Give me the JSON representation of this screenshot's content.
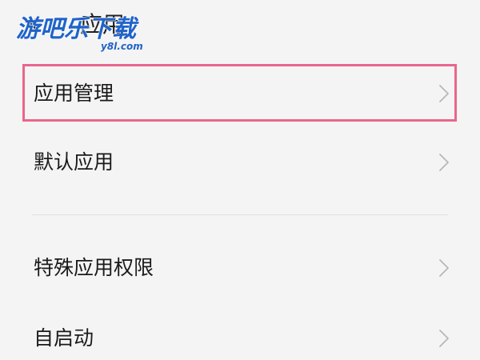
{
  "header": {
    "title": "应用",
    "back_icon": "back-arrow-icon"
  },
  "watermark": {
    "text": "游吧乐下载",
    "site": "y8l.com"
  },
  "settings": {
    "items": [
      {
        "label": "应用管理",
        "highlighted": true
      },
      {
        "label": "默认应用",
        "highlighted": false
      },
      {
        "label": "特殊应用权限",
        "highlighted": false
      },
      {
        "label": "自启动",
        "highlighted": false
      }
    ]
  },
  "colors": {
    "background": "#f4f4f4",
    "highlight_border": "#e8668d",
    "chevron": "#b8b8b8",
    "watermark_blue": "#1f63c9"
  }
}
